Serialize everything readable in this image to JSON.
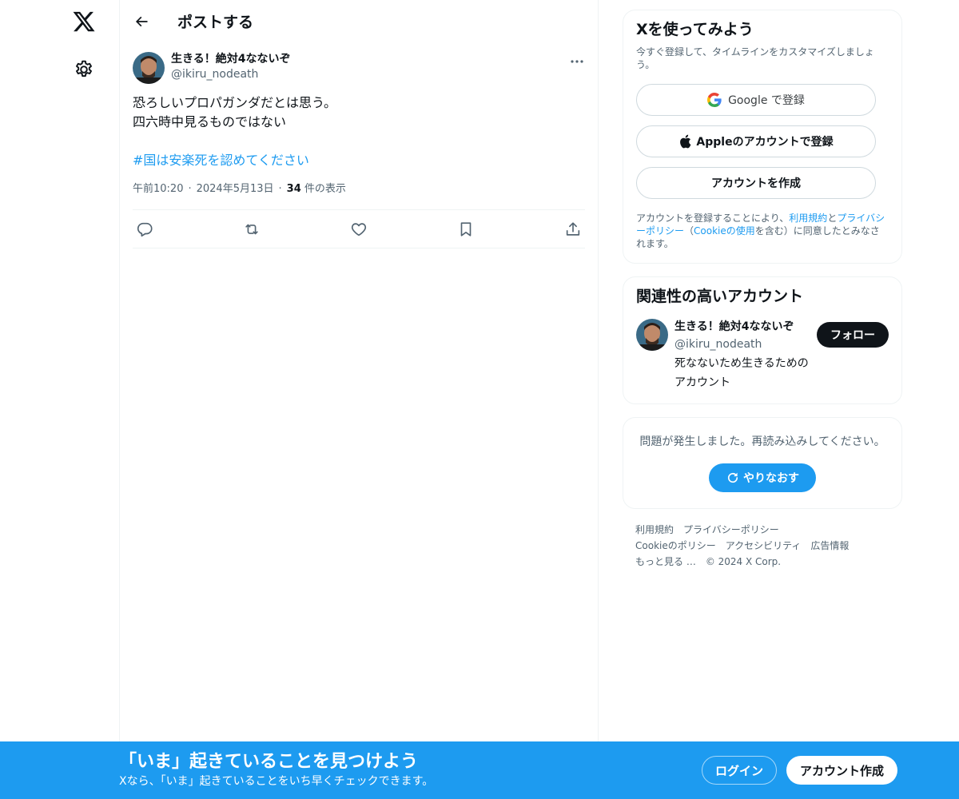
{
  "nav": {
    "logo_icon": "x-logo-icon",
    "settings_icon": "gear-icon"
  },
  "header": {
    "title": "ポストする",
    "back_icon": "arrow-left-icon"
  },
  "post": {
    "author_name": "生きる！絶対4なないぞ",
    "author_handle": "@ikiru_nodeath",
    "text_lines": [
      "恐ろしいプロパガンダだとは思う。",
      "四六時中見るものではない"
    ],
    "hashtag": "#国は安楽死を認めてください",
    "time": "午前10:20",
    "date": "2024年5月13日",
    "views_count": "34",
    "views_label": "件の表示",
    "dot": "·",
    "actions": [
      "reply-icon",
      "repost-icon",
      "like-icon",
      "bookmark-icon",
      "share-icon"
    ]
  },
  "signup_card": {
    "title": "Xを使ってみよう",
    "description": "今すぐ登録して、タイムラインをカスタマイズしましょう。",
    "google_label": "Google で登録",
    "apple_label": "Appleのアカウントで登録",
    "create_label": "アカウントを作成",
    "legal_prefix": "アカウントを登録することにより、",
    "legal_terms": "利用規約",
    "legal_and": "と",
    "legal_privacy": "プライバシーポリシー",
    "legal_open_paren": "（",
    "legal_cookie": "Cookieの使用",
    "legal_suffix": "を含む）に同意したとみなされます。"
  },
  "related_card": {
    "title": "関連性の高いアカウント",
    "account_name": "生きる！絶対4なないぞ",
    "account_handle": "@ikiru_nodeath",
    "account_bio": "死なないため生きるためのアカウント",
    "follow_label": "フォロー"
  },
  "error_card": {
    "message": "問題が発生しました。再読み込みしてください。",
    "retry_label": "やりなおす"
  },
  "footer": {
    "links": [
      "利用規約",
      "プライバシーポリシー",
      "Cookieのポリシー",
      "アクセシビリティ",
      "広告情報",
      "もっと見る …"
    ],
    "copyright": "© 2024 X Corp."
  },
  "bottom_bar": {
    "title": "「いま」起きていることを見つけよう",
    "subtitle": "Xなら、「いま」起きていることをいち早くチェックできます。",
    "login_label": "ログイン",
    "signup_label": "アカウント作成"
  },
  "colors": {
    "accent": "#1d9bf0",
    "text": "#0f1419",
    "secondary": "#536471"
  }
}
